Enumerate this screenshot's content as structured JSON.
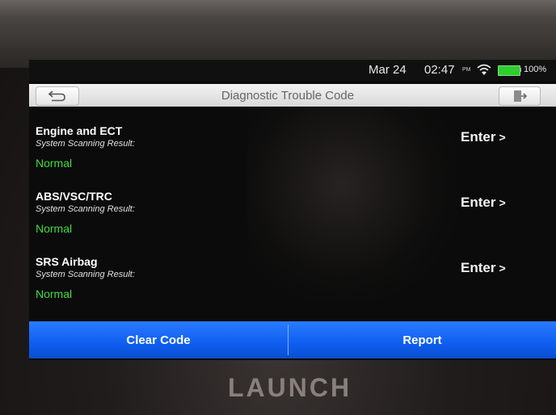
{
  "status_bar": {
    "date": "Mar 24",
    "time": "02:47",
    "ampm": "PM",
    "battery": "100%",
    "wifi_icon": "wifi-icon",
    "battery_icon": "battery-icon"
  },
  "header": {
    "title": "Diagnostic Trouble Code",
    "back_icon": "back-arrow-icon",
    "exit_icon": "exit-door-icon"
  },
  "systems": [
    {
      "name": "Engine and ECT",
      "label": "System Scanning Result:",
      "result": "Normal",
      "enter": "Enter",
      "chevron": ">"
    },
    {
      "name": "ABS/VSC/TRC",
      "label": "System Scanning Result:",
      "result": "Normal",
      "enter": "Enter",
      "chevron": ">"
    },
    {
      "name": "SRS Airbag",
      "label": "System Scanning Result:",
      "result": "Normal",
      "enter": "Enter",
      "chevron": ">"
    }
  ],
  "footer": {
    "clear_code": "Clear Code",
    "report": "Report"
  },
  "brand": "LAUNCH",
  "colors": {
    "accent_blue": "#1565f5",
    "normal_green": "#3fdc3f",
    "title_bar": "#e4e4e4"
  }
}
